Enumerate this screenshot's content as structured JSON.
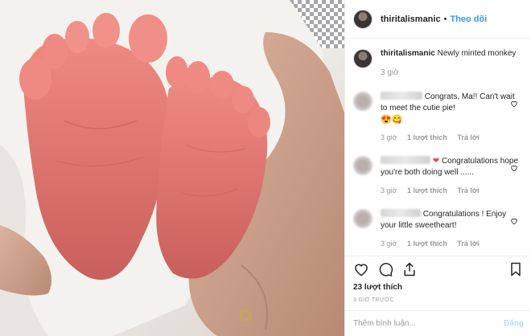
{
  "post": {
    "username": "thiritalismanic",
    "follow_label": "Theo dõi",
    "caption_text": "Newly minted monkey",
    "caption_time": "3 giờ",
    "likes": "23 lượt thích",
    "time_ago": "3 GIỜ TRƯỚC"
  },
  "comments": [
    {
      "text": "Congrats, Ma!! Can't wait to meet the cutie pie!",
      "emoji": "😍😋",
      "time": "3 giờ",
      "likes": "1 lượt thích",
      "reply": "Trả lời"
    },
    {
      "text": "Congratulations hope you're both doing well ......",
      "time": "3 giờ",
      "likes": "1 lượt thích",
      "reply": "Trả lời"
    },
    {
      "text": "Congratulations ! Enjoy your little sweetheart!",
      "time": "3 giờ",
      "likes": "1 lượt thích",
      "reply": "Trả lời"
    }
  ],
  "comment_box": {
    "placeholder": "Thêm bình luận...",
    "post_label": "Đăng"
  },
  "colors": {
    "link": "#3897f0",
    "muted": "#999999",
    "post_disabled": "#b2dffc"
  }
}
